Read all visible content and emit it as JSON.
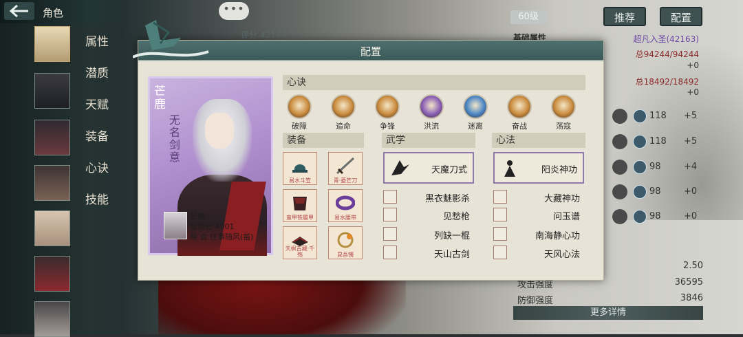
{
  "header": {
    "back_icon": "back-arrow-icon",
    "title": "角色",
    "chat_icon": "chat-bubble-icon",
    "chat_label": "•••"
  },
  "score_text": "评分 42163",
  "sidebar": {
    "items": [
      {
        "label": "属性"
      },
      {
        "label": "潜质"
      },
      {
        "label": "天赋"
      },
      {
        "label": "装备"
      },
      {
        "label": "心诀"
      },
      {
        "label": "技能"
      }
    ]
  },
  "right_panel": {
    "level": "60级",
    "recommend_label": "推荐",
    "config_label": "配置",
    "base_attr_label": "基础属性",
    "rank_text": "超凡入圣(42163)",
    "hp_text": "总94244/94244",
    "hp_add": "+0",
    "mp_text": "总18492/18492",
    "mp_add": "+0",
    "stats": [
      {
        "value": "118",
        "add": "+5"
      },
      {
        "value": "118",
        "add": "+5"
      },
      {
        "value": "98",
        "add": "+4"
      },
      {
        "value": "98",
        "add": "+0"
      },
      {
        "value": "98",
        "add": "+0"
      }
    ],
    "bottom_stats": [
      {
        "label": "",
        "value": "2.50"
      },
      {
        "label": "攻击强度",
        "value": "36595"
      },
      {
        "label": "防御强度",
        "value": "3846"
      }
    ],
    "more_label": "更多详情"
  },
  "modal": {
    "title": "配置",
    "card": {
      "name": "芒鹿",
      "title": "无名剑意",
      "info_name": "芒鹿",
      "rank_line": "论剑分 4001",
      "guild_line": "帮 会 往事随风(苗)"
    },
    "xinjue": {
      "header": "心诀",
      "skills": [
        {
          "label": "破障",
          "color": "#c98a3c"
        },
        {
          "label": "追命",
          "color": "#c98a3c"
        },
        {
          "label": "争锋",
          "color": "#c98a3c"
        },
        {
          "label": "洪流",
          "color": "#8b5fb5"
        },
        {
          "label": "迷离",
          "color": "#4b86c4"
        },
        {
          "label": "奋战",
          "color": "#c98a3c"
        },
        {
          "label": "荡寇",
          "color": "#c98a3c"
        }
      ]
    },
    "equipment": {
      "header": "装备",
      "items": [
        {
          "label": "易水斗笠",
          "art": "hat-icon"
        },
        {
          "label": "青·菱芒刀",
          "art": "sword-icon"
        },
        {
          "label": "蛮甲铁履甲",
          "art": "armor-icon"
        },
        {
          "label": "易水腰带",
          "art": "belt-icon"
        },
        {
          "label": "天枫古藏·千殇",
          "art": "book-icon"
        },
        {
          "label": "昆吾镯",
          "art": "bracelet-icon"
        }
      ]
    },
    "wuxue": {
      "header": "武学",
      "main": "天魔刀式",
      "list": [
        "黑衣魅影杀",
        "见愁枪",
        "列缺一棍",
        "天山古剑"
      ]
    },
    "xinfa": {
      "header": "心法",
      "main": "阳炎神功",
      "list": [
        "大藏神功",
        "问玉谱",
        "南海静心功",
        "天风心法"
      ]
    }
  }
}
